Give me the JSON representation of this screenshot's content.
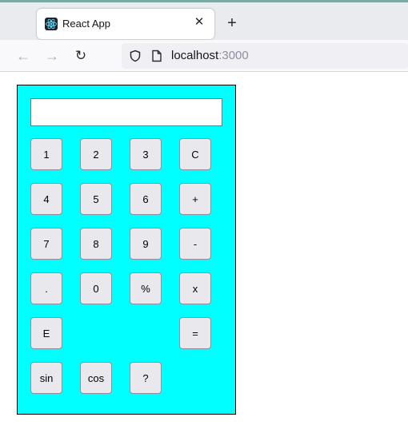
{
  "browser": {
    "tab_title": "React App",
    "tab_close": "✕",
    "new_tab": "+",
    "back": "←",
    "forward": "→",
    "reload": "↻",
    "url_host": "localhost",
    "url_port": ":3000"
  },
  "calculator": {
    "display_value": "",
    "keys": {
      "k1": "1",
      "k2": "2",
      "k3": "3",
      "clear": "C",
      "k4": "4",
      "k5": "5",
      "k6": "6",
      "plus": "+",
      "k7": "7",
      "k8": "8",
      "k9": "9",
      "minus": "-",
      "dot": ".",
      "k0": "0",
      "percent": "%",
      "multiply": "x",
      "exp": "E",
      "equals": "=",
      "sin": "sin",
      "cos": "cos",
      "unknown": "?"
    }
  }
}
